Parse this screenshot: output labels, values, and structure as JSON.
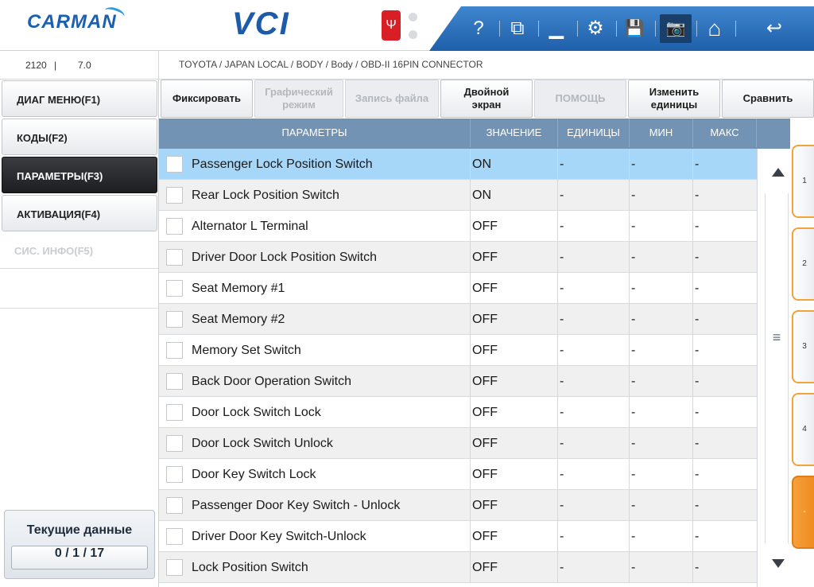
{
  "header": {
    "brand": "CARMAN",
    "product": "VCI",
    "toolbar": {
      "help_icon": "question-icon",
      "icons": [
        "question-icon",
        "window-icon",
        "minimize-icon",
        "settings-icon",
        "save-icon",
        "camera-icon",
        "home-icon",
        "back-icon"
      ],
      "help_glyph": "?",
      "window_glyph": "⧉",
      "minimize_glyph": "▁",
      "settings_glyph": "⚙",
      "save_glyph": "💾",
      "camera_glyph": "📷",
      "home_glyph": "⌂",
      "back_glyph": "↩"
    },
    "usb_glyph": "Ψ",
    "accent_color": "#1e5fa8"
  },
  "info": {
    "code": "2120",
    "separator": "|",
    "version": "7.0",
    "breadcrumb": "TOYOTA / JAPAN LOCAL / BODY / Body / OBD-II 16PIN CONNECTOR"
  },
  "menu": {
    "items": [
      {
        "label": "ДИАГ МЕНЮ(F1)"
      },
      {
        "label": "КОДЫ(F2)"
      },
      {
        "label": "ПАРАМЕТРЫ(F3)"
      },
      {
        "label": "АКТИВАЦИЯ(F4)"
      },
      {
        "label": "СИС. ИНФО(F5)"
      }
    ],
    "status_title": "Текущие данные",
    "status_count": "0 / 1 / 17"
  },
  "functions": {
    "fix": "Фиксировать",
    "graph": "Графический\nрежим",
    "record": "Запись файла",
    "dual": "Двойной\nэкран",
    "help": "ПОМОЩЬ",
    "units": "Изменить\nединицы",
    "compare": "Сравнить"
  },
  "table": {
    "headers": {
      "param": "ПАРАМЕТРЫ",
      "value": "ЗНАЧЕНИЕ",
      "unit": "ЕДИНИЦЫ",
      "min": "МИН",
      "max": "МАКС"
    },
    "rows": [
      {
        "name": "Passenger Lock Position Switch",
        "value": "ON",
        "unit": "-",
        "min": "-",
        "max": "-"
      },
      {
        "name": "Rear Lock Position Switch",
        "value": "ON",
        "unit": "-",
        "min": "-",
        "max": "-"
      },
      {
        "name": "Alternator L Terminal",
        "value": "OFF",
        "unit": "-",
        "min": "-",
        "max": "-"
      },
      {
        "name": "Driver Door Lock Position Switch",
        "value": "OFF",
        "unit": "-",
        "min": "-",
        "max": "-"
      },
      {
        "name": "Seat Memory #1",
        "value": "OFF",
        "unit": "-",
        "min": "-",
        "max": "-"
      },
      {
        "name": "Seat Memory #2",
        "value": "OFF",
        "unit": "-",
        "min": "-",
        "max": "-"
      },
      {
        "name": "Memory Set Switch",
        "value": "OFF",
        "unit": "-",
        "min": "-",
        "max": "-"
      },
      {
        "name": "Back Door Operation Switch",
        "value": "OFF",
        "unit": "-",
        "min": "-",
        "max": "-"
      },
      {
        "name": "Door Lock Switch Lock",
        "value": "OFF",
        "unit": "-",
        "min": "-",
        "max": "-"
      },
      {
        "name": "Door Lock Switch Unlock",
        "value": "OFF",
        "unit": "-",
        "min": "-",
        "max": "-"
      },
      {
        "name": "Door Key Switch Lock",
        "value": "OFF",
        "unit": "-",
        "min": "-",
        "max": "-"
      },
      {
        "name": "Passenger Door Key Switch - Unlock",
        "value": "OFF",
        "unit": "-",
        "min": "-",
        "max": "-"
      },
      {
        "name": "Driver Door Key Switch-Unlock",
        "value": "OFF",
        "unit": "-",
        "min": "-",
        "max": "-"
      },
      {
        "name": "Lock Position Switch",
        "value": "OFF",
        "unit": "-",
        "min": "-",
        "max": "-"
      }
    ]
  },
  "scroll": {
    "thumb_glyph": "≡"
  },
  "page_tabs": [
    "1",
    "2",
    "3",
    "4",
    "-"
  ]
}
